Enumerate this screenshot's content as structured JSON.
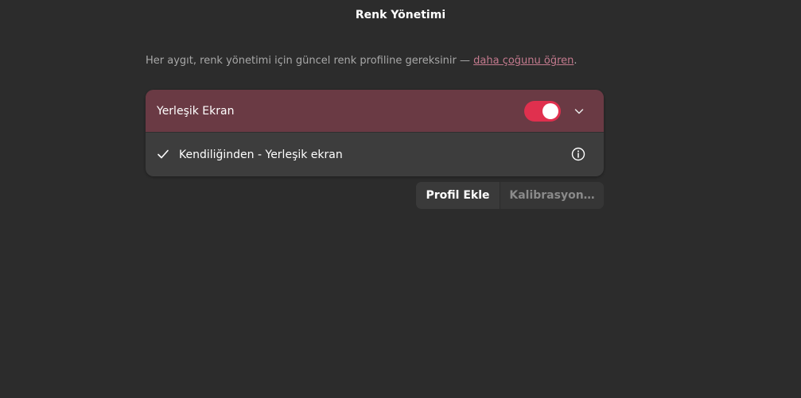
{
  "window": {
    "title": "Renk Yönetimi"
  },
  "intro": {
    "text": "Her aygıt, renk yönetimi için güncel renk profiline gereksinir — ",
    "link_text": "daha çoğunu öğren",
    "suffix": "."
  },
  "device": {
    "name": "Yerleşik Ekran",
    "color_managed": true,
    "toggle_color": "#e0304e",
    "header_color": "#6a3a44",
    "profiles": [
      {
        "label": "Kendiliğinden - Yerleşik ekran",
        "selected": true
      }
    ]
  },
  "actions": {
    "add_profile_label": "Profil Ekle",
    "calibrate_label": "Kalibrasyon…"
  },
  "icons": {
    "expand": "chevron-down-icon",
    "check": "check-icon",
    "info": "info-icon"
  }
}
